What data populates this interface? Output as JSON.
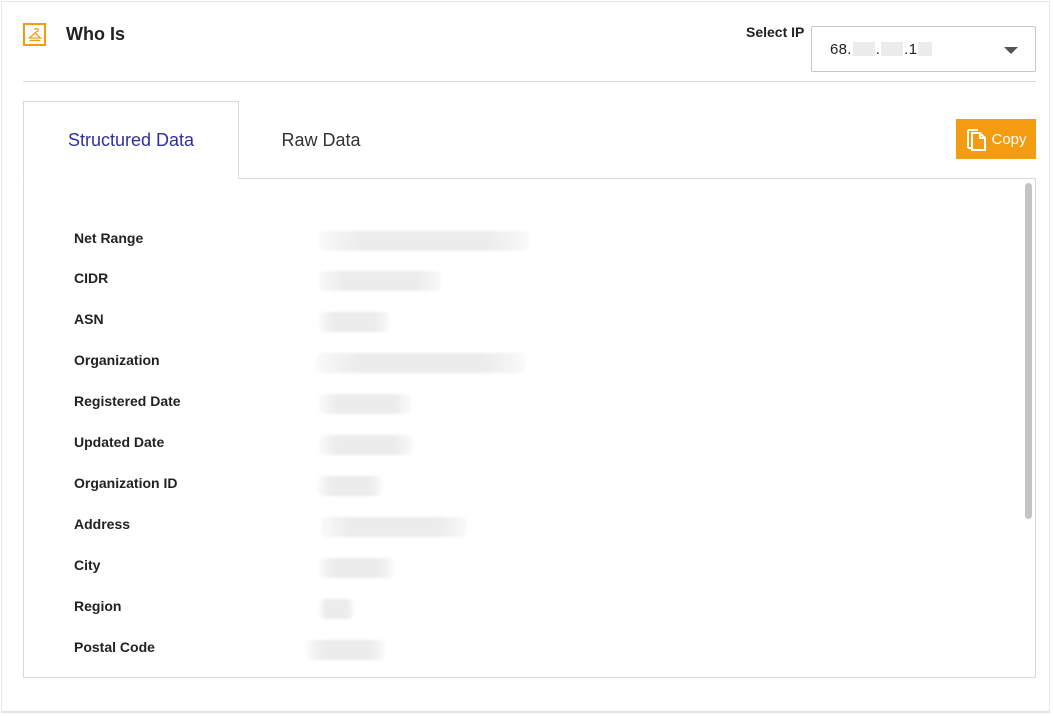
{
  "header": {
    "title": "Who Is",
    "icon": "hanger-icon",
    "select_label": "Select IP",
    "ip": {
      "prefix": "68.",
      "dot": ".",
      "suffix": ".1"
    }
  },
  "tabs": [
    {
      "label": "Structured Data",
      "active": true
    },
    {
      "label": "Raw Data",
      "active": false
    }
  ],
  "copy_button": {
    "label": "Copy",
    "icon": "copy-icon"
  },
  "fields": [
    {
      "label": "Net Range"
    },
    {
      "label": "CIDR"
    },
    {
      "label": "ASN"
    },
    {
      "label": "Organization"
    },
    {
      "label": "Registered Date"
    },
    {
      "label": "Updated Date"
    },
    {
      "label": "Organization ID"
    },
    {
      "label": "Address"
    },
    {
      "label": "City"
    },
    {
      "label": "Region"
    },
    {
      "label": "Postal Code"
    }
  ],
  "colors": {
    "accent": "#f39c12",
    "active_tab": "#2f2fa2"
  }
}
